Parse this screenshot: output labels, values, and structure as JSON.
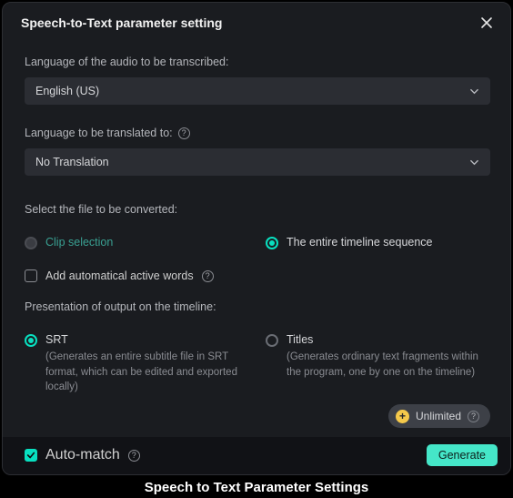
{
  "dialog": {
    "title": "Speech-to-Text parameter setting"
  },
  "audioLang": {
    "label": "Language of the audio to be transcribed:",
    "value": "English (US)"
  },
  "translateLang": {
    "label": "Language to be translated to:",
    "value": "No Translation"
  },
  "fileSelect": {
    "label": "Select the file to be converted:",
    "options": {
      "clip": "Clip selection",
      "timeline": "The entire timeline sequence"
    },
    "selected": "timeline"
  },
  "activeWords": {
    "label": "Add automatical active words"
  },
  "presentation": {
    "label": "Presentation of output on the timeline:",
    "srt": {
      "title": "SRT",
      "desc": "(Generates an entire subtitle file in SRT format, which can be edited and exported locally)"
    },
    "titles": {
      "title": "Titles",
      "desc": "(Generates ordinary text fragments within the program, one by one on the timeline)"
    },
    "selected": "srt"
  },
  "pill": {
    "label": "Unlimited"
  },
  "autoMatch": {
    "label": "Auto-match"
  },
  "buttons": {
    "generate": "Generate"
  },
  "caption": "Speech to Text Parameter Settings"
}
